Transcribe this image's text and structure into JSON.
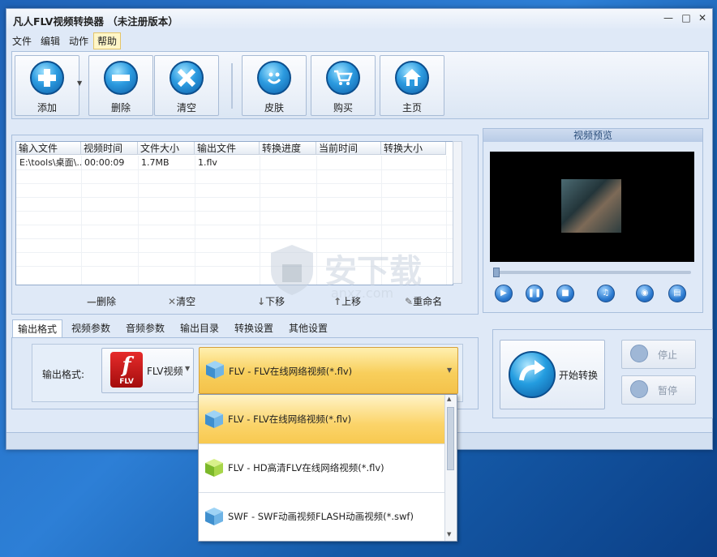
{
  "window": {
    "title": "凡人FLV视频转换器 （未注册版本）"
  },
  "menu": [
    "文件",
    "编辑",
    "动作",
    "帮助"
  ],
  "toolbar": {
    "add": "添加",
    "delete": "删除",
    "clear": "清空",
    "skin": "皮肤",
    "buy": "购买",
    "home": "主页"
  },
  "table": {
    "headers": [
      "输入文件",
      "视频时间",
      "文件大小",
      "输出文件",
      "转换进度",
      "当前时间",
      "转换大小"
    ],
    "rows": [
      [
        "E:\\tools\\桌面\\...",
        "00:00:09",
        "1.7MB",
        "1.flv",
        "",
        "",
        ""
      ]
    ]
  },
  "list_actions": {
    "delete": "删除",
    "clear": "清空",
    "down": "下移",
    "up": "上移",
    "rename": "重命名"
  },
  "preview": {
    "title": "视频预览"
  },
  "tabs": [
    "输出格式",
    "视频参数",
    "音频参数",
    "输出目录",
    "转换设置",
    "其他设置"
  ],
  "format": {
    "label": "输出格式:",
    "category": "FLV视频",
    "logo_text": "FLV",
    "selected": "FLV - FLV在线网络视频(*.flv)",
    "options": [
      "FLV - FLV在线网络视频(*.flv)",
      "FLV - HD高清FLV在线网络视频(*.flv)",
      "SWF - SWF动画视频FLASH动画视频(*.swf)"
    ]
  },
  "convert": {
    "start": "开始转换",
    "stop": "停止",
    "pause": "暂停"
  },
  "watermark": {
    "text": "安下载",
    "sub": "anxz.com"
  },
  "colors": {
    "accent": "#2c9be0",
    "selection": "#f8cf5c",
    "window_bg": "#dfe9f7"
  }
}
